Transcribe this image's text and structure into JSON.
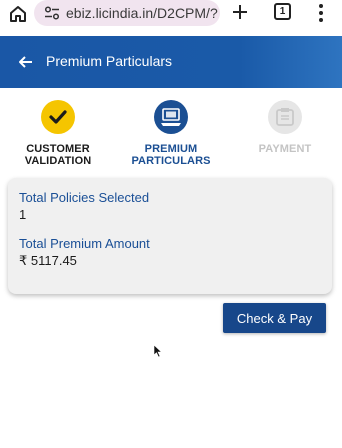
{
  "browser": {
    "url": "ebiz.licindia.in/D2CPM/?",
    "tab_count": "1"
  },
  "header": {
    "title": "Premium Particulars"
  },
  "stepper": {
    "steps": [
      {
        "line1": "CUSTOMER",
        "line2": "VALIDATION",
        "state": "completed",
        "icon": "check-icon"
      },
      {
        "line1": "PREMIUM",
        "line2": "PARTICULARS",
        "state": "active",
        "icon": "computer-icon"
      },
      {
        "line1": "PAYMENT",
        "line2": "",
        "state": "pending",
        "icon": "wallet-icon"
      }
    ]
  },
  "summary": {
    "policies_label": "Total Policies Selected",
    "policies_value": "1",
    "premium_label": "Total Premium Amount",
    "premium_value": "₹ 5117.45"
  },
  "actions": {
    "check_pay_label": "Check & Pay"
  },
  "colors": {
    "header_blue": "#1a57a6",
    "accent_yellow": "#f5c500",
    "label_blue": "#1a4f96",
    "button_blue": "#17478a"
  }
}
